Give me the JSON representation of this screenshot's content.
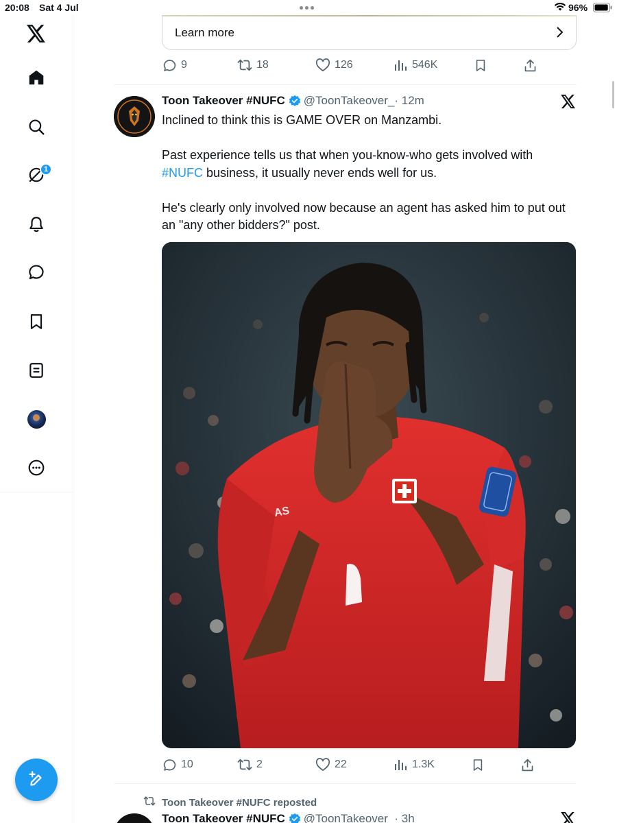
{
  "status_bar": {
    "time": "20:08",
    "date": "Sat 4 Jul",
    "battery_percent": "96%",
    "battery_level": 0.96
  },
  "sidebar": {
    "items": [
      {
        "name": "home",
        "icon": "home-icon"
      },
      {
        "name": "explore",
        "icon": "search-icon"
      },
      {
        "name": "grok",
        "icon": "grok-icon",
        "badge": "1"
      },
      {
        "name": "notifications",
        "icon": "bell-icon"
      },
      {
        "name": "messages",
        "icon": "message-icon"
      },
      {
        "name": "bookmarks",
        "icon": "bookmark-icon"
      },
      {
        "name": "lists",
        "icon": "list-icon"
      },
      {
        "name": "profile",
        "icon": "avatar"
      },
      {
        "name": "more",
        "icon": "more-icon"
      }
    ],
    "compose_icon": "compose-icon"
  },
  "previous_tweet": {
    "learn_more_label": "Learn more",
    "replies": "9",
    "reposts": "18",
    "likes": "126",
    "views": "546K"
  },
  "tweet": {
    "author_name": "Toon Takeover #NUFC",
    "author_handle": "@ToonTakeover_",
    "time": "· 12m",
    "line1": "Inclined to think this is GAME OVER on Manzambi.",
    "para2_start": "Past experience tells us that when you-know-who gets involved with",
    "hashtag": "#NUFC",
    "para2_end": " business, it usually never ends well for us.",
    "para3": "He's clearly only involved now because an agent has asked him to put out an \"any other bidders?\" post.",
    "replies": "10",
    "reposts": "2",
    "likes": "22",
    "views": "1.3K"
  },
  "next_tweet": {
    "repost_label": "Toon Takeover #NUFC reposted",
    "author_name": "Toon Takeover #NUFC",
    "author_handle": "@ToonTakeover_",
    "time": "· 3h"
  },
  "colors": {
    "accent": "#1d9bf0",
    "text": "#0f1419",
    "secondary": "#536471",
    "divider": "#eff3f4",
    "shirt": "#d92a2a"
  }
}
